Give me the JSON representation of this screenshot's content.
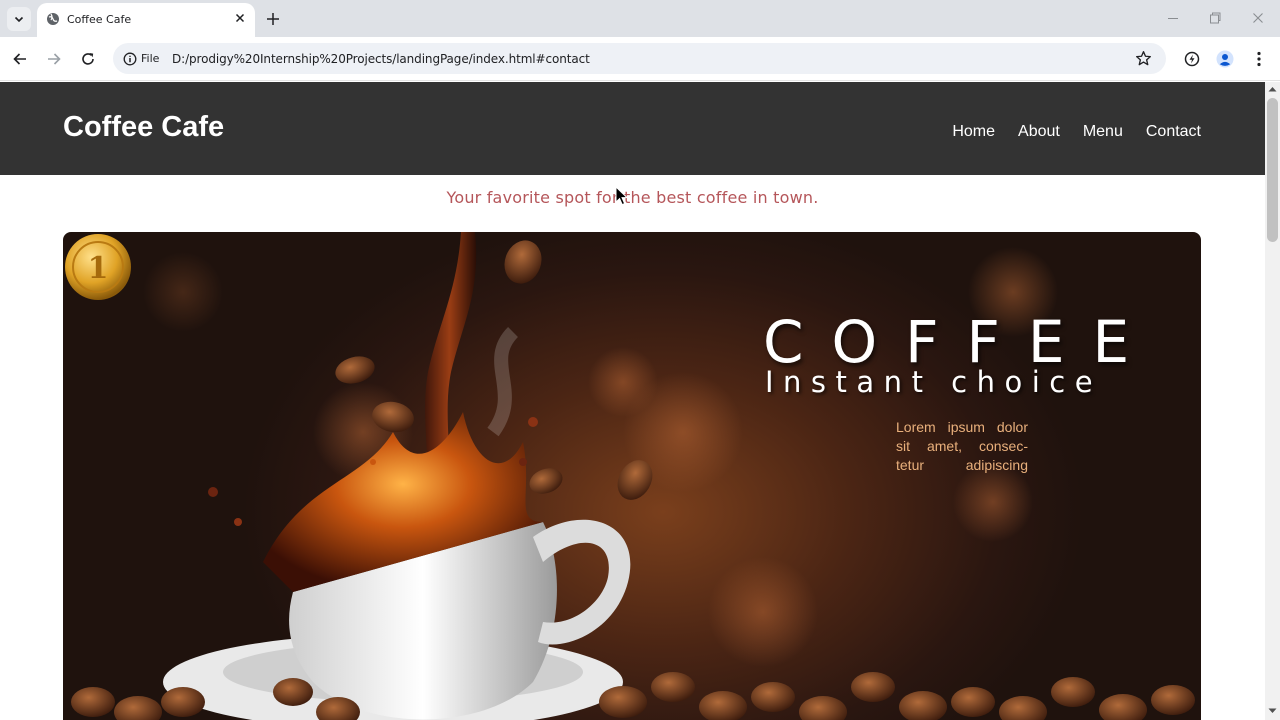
{
  "browser": {
    "tab": {
      "title": "Coffee Cafe"
    },
    "address": {
      "scheme_label": "File",
      "url": "D:/prodigy%20Internship%20Projects/landingPage/index.html#contact"
    }
  },
  "page": {
    "brand": "Coffee Cafe",
    "nav": [
      {
        "label": "Home"
      },
      {
        "label": "About"
      },
      {
        "label": "Menu"
      },
      {
        "label": "Contact"
      }
    ],
    "tagline": "Your favorite spot for the best coffee in town.",
    "hero": {
      "title": "COFFEE",
      "subtitle": "Instant choice",
      "body": "Lorem ipsum dolor sit amet, consec- tetur adipiscing",
      "badge": "1"
    }
  },
  "colors": {
    "header_bg": "#333333",
    "tagline": "#b5565a",
    "hero_accent": "#e9b07c"
  },
  "icons": [
    "tab-search-icon",
    "globe-icon",
    "close-icon",
    "plus-icon",
    "minimize-icon",
    "restore-icon",
    "window-close-icon",
    "back-icon",
    "forward-icon",
    "reload-icon",
    "info-icon",
    "star-icon",
    "extension-icon",
    "profile-icon",
    "kebab-menu-icon"
  ]
}
